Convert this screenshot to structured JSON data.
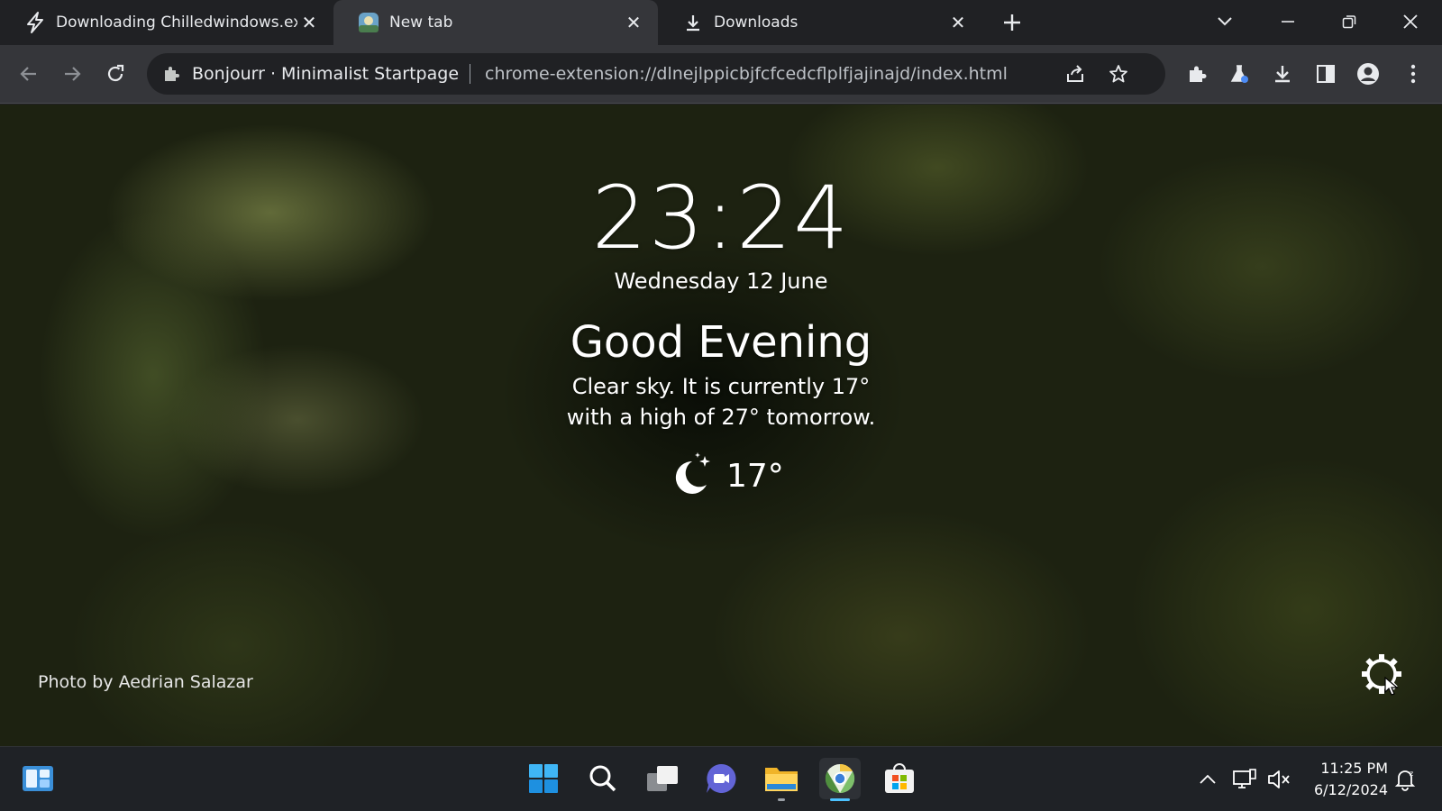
{
  "tabs": [
    {
      "title": "Downloading Chilledwindows.exe",
      "icon": "lightning-icon",
      "active": false
    },
    {
      "title": "New tab",
      "icon": "bonjourr-icon",
      "active": true
    },
    {
      "title": "Downloads",
      "icon": "download-icon",
      "active": false
    }
  ],
  "omnibox": {
    "site_name": "Bonjourr · Minimalist Startpage",
    "url": "chrome-extension://dlnejlppicbjfcfcedcflplfjajinajd/index.html"
  },
  "startpage": {
    "time": "23:24",
    "date": "Wednesday 12 June",
    "greeting": "Good Evening",
    "description_line1": "Clear sky. It is currently 17°",
    "description_line2": "with a high of 27° tomorrow.",
    "current_temp": "17°",
    "weather_icon": "moon-stars-icon",
    "photo_credit": "Photo by Aedrian Salazar"
  },
  "taskbar": {
    "apps": [
      "widgets-icon",
      "start-icon",
      "search-icon",
      "task-view-icon",
      "teams-chat-icon",
      "file-explorer-icon",
      "chrome-canary-icon",
      "store-icon"
    ],
    "tray_time": "11:25 PM",
    "tray_date": "6/12/2024"
  },
  "colors": {
    "accent_indicator": "#4cc2ff",
    "page_text": "#ffffff"
  }
}
